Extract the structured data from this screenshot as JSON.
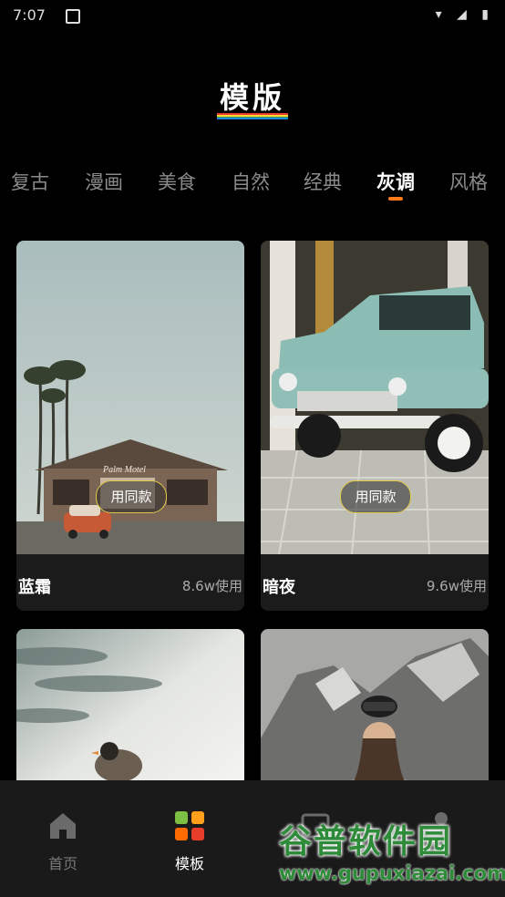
{
  "status_bar": {
    "time": "7:07",
    "system_icons": "wifi-icon signal-icon battery-icon"
  },
  "header": {
    "title": "模版"
  },
  "tabs": [
    {
      "label": "复古"
    },
    {
      "label": "漫画"
    },
    {
      "label": "美食"
    },
    {
      "label": "自然"
    },
    {
      "label": "经典"
    },
    {
      "label": "灰调",
      "active": true
    },
    {
      "label": "风格"
    }
  ],
  "cards": [
    {
      "name": "蓝霜",
      "uses": "8.6w使用",
      "button": "用同款"
    },
    {
      "name": "暗夜",
      "uses": "9.6w使用",
      "button": "用同款"
    },
    {
      "name": "",
      "uses": "",
      "button": ""
    },
    {
      "name": "",
      "uses": "",
      "button": ""
    }
  ],
  "bottom_nav": [
    {
      "label": "首页",
      "icon": "home-icon"
    },
    {
      "label": "模板",
      "icon": "template-grid-icon",
      "active": true
    },
    {
      "label": "",
      "icon": "image-icon"
    },
    {
      "label": "",
      "icon": "profile-icon"
    }
  ],
  "watermark": {
    "main": "谷普软件园",
    "url": "www.gupuxiazai.com"
  },
  "colors": {
    "accent": "#ff7a1a",
    "button_border": "#e0c84a",
    "background": "#000000",
    "nav_bg": "#1a1a1a"
  }
}
